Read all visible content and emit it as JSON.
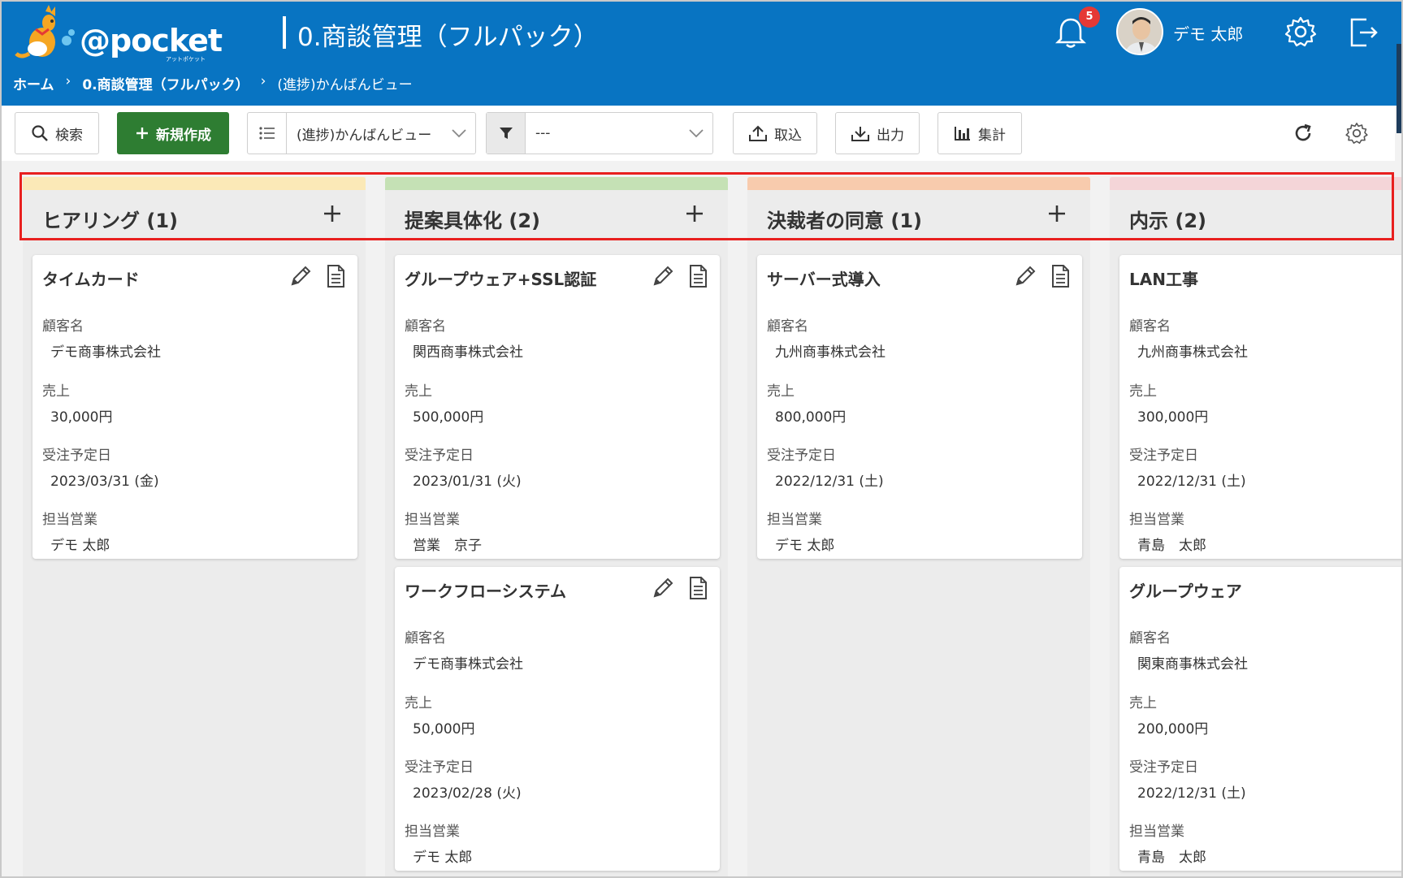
{
  "header": {
    "logo_text": "@pocket",
    "logo_sub": "アットポケット",
    "app_title": "0.商談管理（フルパック）",
    "notification_count": "5",
    "user_name": "デモ 太郎",
    "colors": {
      "header_bg": "#0874c2",
      "badge": "#e53935"
    }
  },
  "breadcrumb": {
    "home": "ホーム",
    "sep1": "›",
    "app": "0.商談管理（フルパック）",
    "sep2": "›",
    "view": "(進捗)かんばんビュー"
  },
  "toolbar": {
    "search_label": "検索",
    "new_label": "新規作成",
    "view_select": "(進捗)かんばんビュー",
    "filter_select": "---",
    "import_label": "取込",
    "export_label": "出力",
    "aggregate_label": "集計",
    "icons": [
      "search-icon",
      "plus-icon",
      "list-icon",
      "filter-icon",
      "upload-icon",
      "download-icon",
      "bar-chart-icon",
      "refresh-icon",
      "gear-icon"
    ]
  },
  "field_labels": {
    "customer": "顧客名",
    "sales": "売上",
    "order_date": "受注予定日",
    "rep": "担当営業"
  },
  "columns": [
    {
      "title": "ヒアリング (1)",
      "stripe_color": "#fbe9b7",
      "cards": [
        {
          "title": "タイムカード",
          "customer": "デモ商事株式会社",
          "sales": "30,000円",
          "order_date": "2023/03/31 (金)",
          "rep": "デモ 太郎"
        }
      ]
    },
    {
      "title": "提案具体化 (2)",
      "stripe_color": "#c5e1b5",
      "cards": [
        {
          "title": "グループウェア+SSL認証",
          "customer": "関西商事株式会社",
          "sales": "500,000円",
          "order_date": "2023/01/31 (火)",
          "rep": "営業　京子"
        },
        {
          "title": "ワークフローシステム",
          "customer": "デモ商事株式会社",
          "sales": "50,000円",
          "order_date": "2023/02/28 (火)",
          "rep": "デモ 太郎"
        }
      ]
    },
    {
      "title": "決裁者の同意 (1)",
      "stripe_color": "#f8cbad",
      "cards": [
        {
          "title": "サーバー式導入",
          "customer": "九州商事株式会社",
          "sales": "800,000円",
          "order_date": "2022/12/31 (土)",
          "rep": "デモ 太郎"
        }
      ]
    },
    {
      "title": "内示 (2)",
      "stripe_color": "#f4d5d8",
      "cards": [
        {
          "title": "LAN工事",
          "customer": "九州商事株式会社",
          "sales": "300,000円",
          "order_date": "2022/12/31 (土)",
          "rep": "青島　太郎"
        },
        {
          "title": "グループウェア",
          "customer": "関東商事株式会社",
          "sales": "200,000円",
          "order_date": "2022/12/31 (土)",
          "rep": "青島　太郎"
        }
      ]
    }
  ]
}
